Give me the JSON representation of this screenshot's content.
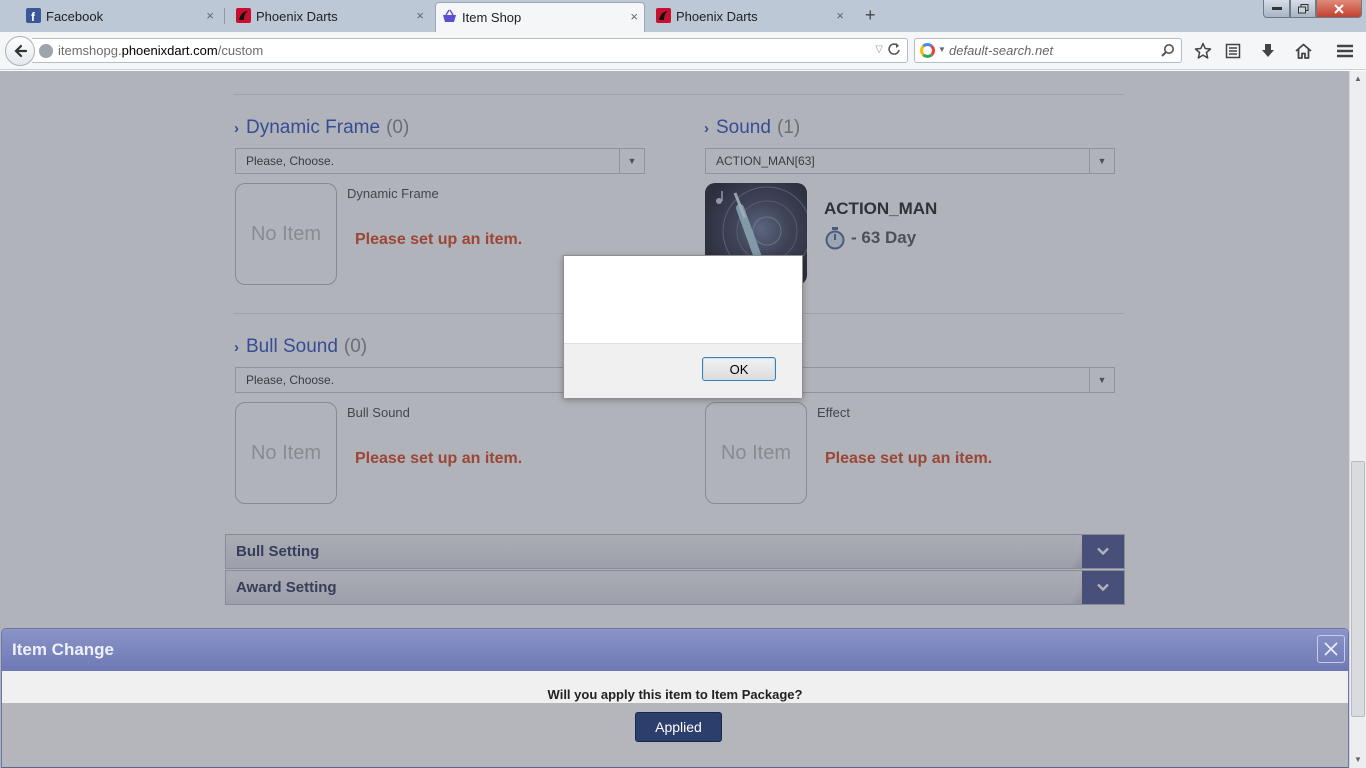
{
  "browser": {
    "tabs": [
      {
        "label": "Facebook",
        "close": "×"
      },
      {
        "label": "Phoenix Darts",
        "close": "×"
      },
      {
        "label": "Item Shop",
        "close": "×"
      },
      {
        "label": "Phoenix Darts",
        "close": "×"
      }
    ],
    "new_tab": "+",
    "url": {
      "prefix": "itemshopg.",
      "host": "phoenixdart.com",
      "path": "/custom"
    },
    "search_placeholder": "default-search.net"
  },
  "colors": {
    "accent": "#2c4fc0",
    "warning": "#d9441c",
    "panel_header": "#6e79b5"
  },
  "sections": {
    "dynamic_frame": {
      "title": "Dynamic Frame",
      "count": "(0)",
      "select_value": "Please, Choose.",
      "thumb": "No Item",
      "label": "Dynamic Frame",
      "message": "Please set up an item."
    },
    "sound": {
      "title": "Sound",
      "count": "(1)",
      "select_value": "ACTION_MAN[63]",
      "item_name": "ACTION_MAN",
      "duration": "- 63 Day"
    },
    "bull_sound": {
      "title": "Bull Sound",
      "count": "(0)",
      "select_value": "Please, Choose.",
      "thumb": "No Item",
      "label": "Bull Sound",
      "message": "Please set up an item."
    },
    "effect": {
      "thumb": "No Item",
      "label": "Effect",
      "message": "Please set up an item."
    }
  },
  "accordions": {
    "bull_setting": "Bull Setting",
    "award_setting": "Award Setting"
  },
  "item_change": {
    "title": "Item Change",
    "question": "Will you apply this item to Item Package?",
    "apply_label": "Applied"
  },
  "alert": {
    "message": "",
    "ok_label": "OK"
  }
}
